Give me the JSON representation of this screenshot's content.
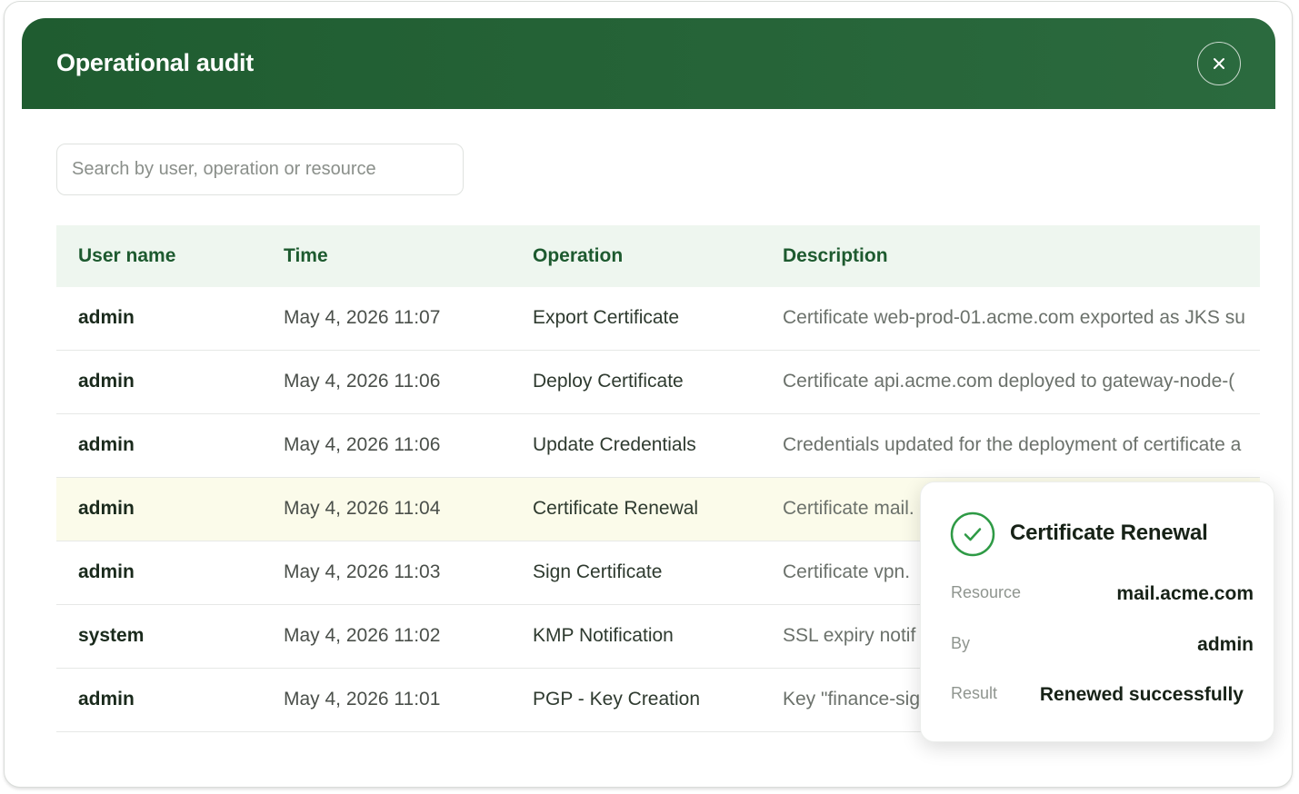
{
  "dialog": {
    "title": "Operational audit",
    "close_icon": "close-icon"
  },
  "search": {
    "placeholder": "Search by user, operation or resource",
    "value": ""
  },
  "table": {
    "columns": [
      "User name",
      "Time",
      "Operation",
      "Description"
    ],
    "rows": [
      {
        "user": "admin",
        "time": "May 4, 2026 11:07",
        "operation": "Export Certificate",
        "description": "Certificate web-prod-01.acme.com exported as JKS su"
      },
      {
        "user": "admin",
        "time": "May 4, 2026 11:06",
        "operation": "Deploy Certificate",
        "description": "Certificate api.acme.com deployed to gateway-node-("
      },
      {
        "user": "admin",
        "time": "May 4, 2026 11:06",
        "operation": "Update Credentials",
        "description": "Credentials updated for the deployment of certificate a"
      },
      {
        "user": "admin",
        "time": "May 4, 2026 11:04",
        "operation": "Certificate Renewal",
        "description": "Certificate mail."
      },
      {
        "user": "admin",
        "time": "May 4, 2026 11:03",
        "operation": "Sign Certificate",
        "description": "Certificate vpn."
      },
      {
        "user": "system",
        "time": "May 4, 2026 11:02",
        "operation": "KMP Notification",
        "description": "SSL expiry notif"
      },
      {
        "user": "admin",
        "time": "May 4, 2026 11:01",
        "operation": "PGP - Key Creation",
        "description": "Key \"finance-sig"
      }
    ],
    "highlighted_row": 3
  },
  "popover": {
    "icon": "check-circle-icon",
    "title": "Certificate Renewal",
    "fields": [
      {
        "label": "Resource",
        "value": "mail.acme.com"
      },
      {
        "label": "By",
        "value": "admin"
      },
      {
        "label": "Result",
        "value": "Renewed successfully"
      }
    ]
  },
  "colors": {
    "header_bg": "#1f5c30",
    "header_text": "#ffffff",
    "table_header_bg": "#eef6ef",
    "table_header_text": "#1d5a2f",
    "highlight_row_bg": "#fbfbea",
    "success_green": "#2e9a45"
  }
}
